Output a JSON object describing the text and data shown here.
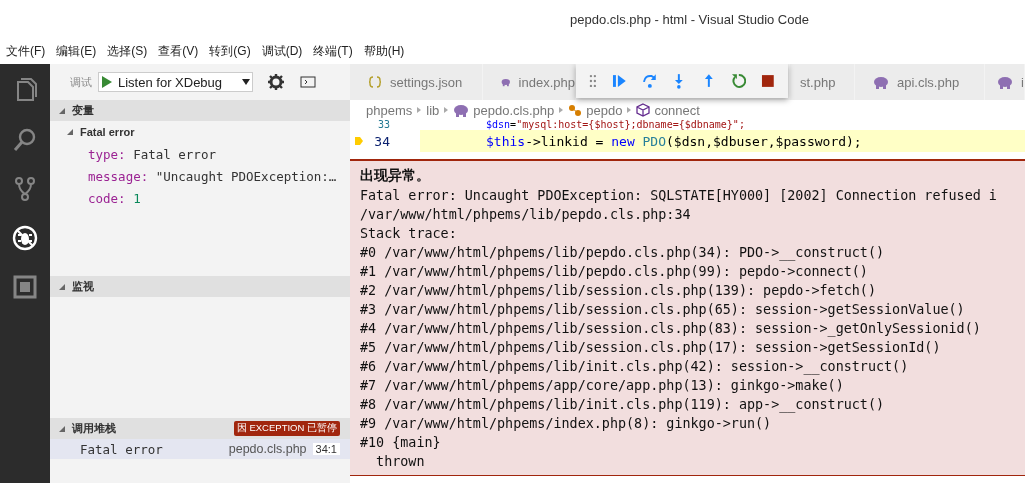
{
  "window": {
    "title": "pepdo.cls.php - html - Visual Studio Code"
  },
  "menu": [
    "文件(F)",
    "编辑(E)",
    "选择(S)",
    "查看(V)",
    "转到(G)",
    "调试(D)",
    "终端(T)",
    "帮助(H)"
  ],
  "activity_bar": [
    {
      "kind": "files",
      "selected": false
    },
    {
      "kind": "search",
      "selected": false
    },
    {
      "kind": "source-control",
      "selected": false
    },
    {
      "kind": "debug",
      "selected": true
    },
    {
      "kind": "extensions",
      "selected": false
    }
  ],
  "debug_toolbar": {
    "label": "调试",
    "configuration": "Listen for XDebug"
  },
  "variables": {
    "title": "变量",
    "expanded": true,
    "scope": {
      "label": "Fatal error",
      "expanded": true,
      "children": [
        {
          "name": "type:",
          "value": "Fatal error",
          "kind": "plain"
        },
        {
          "name": "message:",
          "value": "\"Uncaught PDOException:…",
          "kind": "string"
        },
        {
          "name": "code:",
          "value": "1",
          "kind": "number"
        }
      ]
    }
  },
  "watch": {
    "title": "监视",
    "expanded": true
  },
  "call_stack": {
    "title": "调用堆栈",
    "expanded": true,
    "badge": "因 EXCEPTION 已暂停",
    "frames": [
      {
        "name": "Fatal error",
        "file": "pepdo.cls.php",
        "position": "34:1",
        "selected": true
      }
    ]
  },
  "tabs": [
    {
      "label": "settings.json",
      "kind": "json",
      "selected": false
    },
    {
      "label": "index.php",
      "kind": "php",
      "selected": false
    },
    {
      "label": "st.php",
      "kind": "hidden",
      "selected": false
    },
    {
      "label": "api.cls.php",
      "kind": "php",
      "selected": false
    },
    {
      "label": "i",
      "kind": "php",
      "selected": false
    }
  ],
  "breadcrumb": [
    {
      "label": "phpems",
      "kind": "folder"
    },
    {
      "label": "lib",
      "kind": "folder"
    },
    {
      "label": "pepdo.cls.php",
      "kind": "php"
    },
    {
      "label": "pepdo",
      "kind": "class"
    },
    {
      "label": "connect",
      "kind": "method"
    }
  ],
  "code_lines": [
    {
      "number": "33",
      "current": false,
      "tokens": [
        {
          "text": "$dsn",
          "kind": "variable"
        },
        {
          "text": "=",
          "kind": "plain"
        },
        {
          "text": "\"mysql:host={$host};dbname={$dbname}\";",
          "kind": "string"
        }
      ]
    },
    {
      "number": "34",
      "current": true,
      "tokens": [
        {
          "text": "$this",
          "kind": "variable"
        },
        {
          "text": "->linkid = ",
          "kind": "plain"
        },
        {
          "text": "new ",
          "kind": "keyword"
        },
        {
          "text": "PDO",
          "kind": "type"
        },
        {
          "text": "($dsn,$dbuser,$password);",
          "kind": "plain"
        }
      ]
    }
  ],
  "exception": {
    "title": "出现异常。",
    "lines": [
      "Fatal error: Uncaught PDOException: SQLSTATE[HY000] [2002] Connection refused i",
      "/var/www/html/phpems/lib/pepdo.cls.php:34",
      "Stack trace:",
      "#0 /var/www/html/phpems/lib/pepdo.cls.php(34): PDO->__construct()",
      "#1 /var/www/html/phpems/lib/pepdo.cls.php(99): pepdo->connect()",
      "#2 /var/www/html/phpems/lib/session.cls.php(139): pepdo->fetch()",
      "#3 /var/www/html/phpems/lib/session.cls.php(65): session->getSessionValue()",
      "#4 /var/www/html/phpems/lib/session.cls.php(83): session->_getOnlySessionid()",
      "#5 /var/www/html/phpems/lib/session.cls.php(17): session->getSessionId()",
      "#6 /var/www/html/phpems/lib/init.cls.php(42): session->__construct()",
      "#7 /var/www/html/phpems/app/core/app.php(13): ginkgo->make()",
      "#8 /var/www/html/phpems/lib/init.cls.php(119): app->__construct()",
      "#9 /var/www/html/phpems/index.php(8): ginkgo->run()",
      "#10 {main}",
      "  thrown"
    ]
  }
}
